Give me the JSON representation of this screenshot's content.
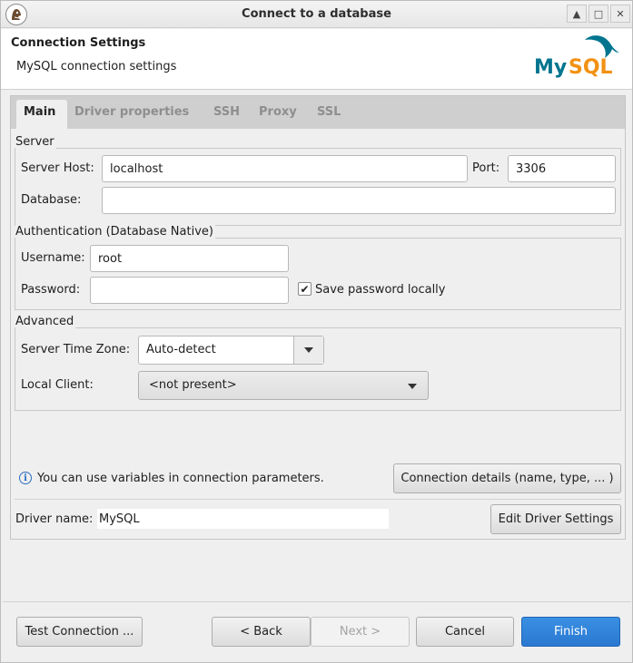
{
  "window": {
    "title": "Connect to a database",
    "controls": [
      "minimize",
      "maximize",
      "close"
    ]
  },
  "header": {
    "title": "Connection Settings",
    "subtitle": "MySQL connection settings",
    "logo_text": "MySQL"
  },
  "tabs": [
    {
      "label": "Main",
      "active": true
    },
    {
      "label": "Driver properties",
      "active": false
    },
    {
      "label": "SSH",
      "active": false
    },
    {
      "label": "Proxy",
      "active": false
    },
    {
      "label": "SSL",
      "active": false
    }
  ],
  "server": {
    "group_label": "Server",
    "host_label": "Server Host:",
    "host_value": "localhost",
    "port_label": "Port:",
    "port_value": "3306",
    "database_label": "Database:",
    "database_value": ""
  },
  "auth": {
    "group_label": "Authentication (Database Native)",
    "username_label": "Username:",
    "username_value": "root",
    "password_label": "Password:",
    "password_value": "",
    "save_password_label": "Save password locally",
    "save_password_checked": true
  },
  "advanced": {
    "group_label": "Advanced",
    "timezone_label": "Server Time Zone:",
    "timezone_value": "Auto-detect",
    "local_client_label": "Local Client:",
    "local_client_value": "<not present>"
  },
  "info": {
    "text": "You can use variables in connection parameters.",
    "connection_details_button": "Connection details (name, type, ... )"
  },
  "driver": {
    "label": "Driver name:",
    "value": "MySQL",
    "edit_button": "Edit Driver Settings"
  },
  "footer": {
    "test_connection": "Test Connection ...",
    "back": "< Back",
    "next": "Next >",
    "cancel": "Cancel",
    "finish": "Finish"
  },
  "colors": {
    "primary_button": "#2a78d1",
    "mysql_blue": "#00758f",
    "mysql_orange": "#f29111"
  }
}
